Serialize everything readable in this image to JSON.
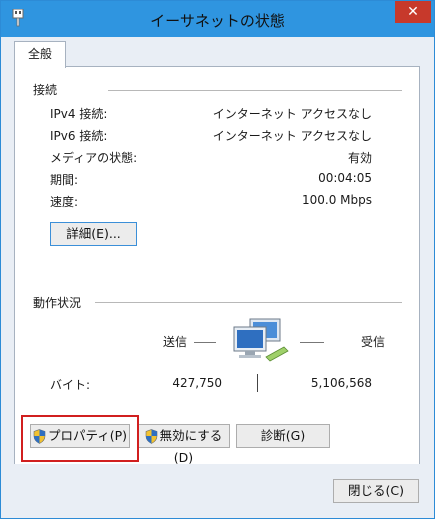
{
  "window": {
    "title": "イーサネットの状態",
    "close_glyph": "✕"
  },
  "tabs": [
    {
      "label": "全般"
    }
  ],
  "connection": {
    "header": "接続",
    "rows": [
      {
        "label": "IPv4 接続:",
        "value": "インターネット アクセスなし"
      },
      {
        "label": "IPv6 接続:",
        "value": "インターネット アクセスなし"
      },
      {
        "label": "メディアの状態:",
        "value": "有効"
      },
      {
        "label": "期間:",
        "value": "00:04:05"
      },
      {
        "label": "速度:",
        "value": "100.0 Mbps"
      }
    ],
    "details_button": "詳細(E)..."
  },
  "activity": {
    "header": "動作状況",
    "sent_label": "送信",
    "received_label": "受信",
    "bytes_label": "バイト:",
    "bytes_sent": "427,750",
    "bytes_received": "5,106,568"
  },
  "buttons": {
    "properties": "プロパティ(P)",
    "disable": "無効にする(D)",
    "diagnose": "診断(G)",
    "close": "閉じる(C)"
  },
  "icons": {
    "app": "network-adapter-icon",
    "activity": "computers-network-icon",
    "shield": "uac-shield-icon"
  },
  "colors": {
    "titlebar": "#2f95e0",
    "close": "#c7392b",
    "highlight": "#d11f1f"
  }
}
